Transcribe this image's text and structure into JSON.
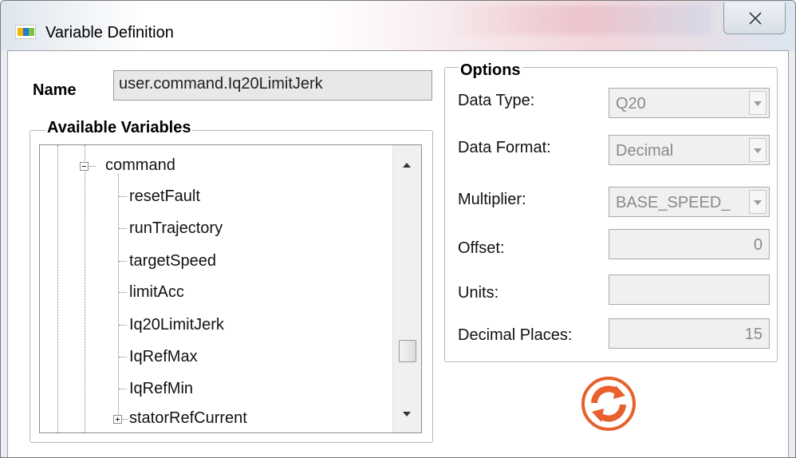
{
  "window": {
    "title": "Variable Definition"
  },
  "name_field": {
    "label": "Name",
    "value": "user.command.Iq20LimitJerk"
  },
  "available_variables": {
    "title": "Available Variables",
    "tree": [
      {
        "label": "command",
        "expander": "minus"
      },
      {
        "label": "resetFault"
      },
      {
        "label": "runTrajectory"
      },
      {
        "label": "targetSpeed"
      },
      {
        "label": "limitAcc"
      },
      {
        "label": "Iq20LimitJerk"
      },
      {
        "label": "IqRefMax"
      },
      {
        "label": "IqRefMin"
      },
      {
        "label": "statorRefCurrent",
        "expander": "plus"
      }
    ]
  },
  "options": {
    "title": "Options",
    "data_type": {
      "label": "Data Type:",
      "value": "Q20"
    },
    "data_format": {
      "label": "Data Format:",
      "value": "Decimal"
    },
    "multiplier": {
      "label": "Multiplier:",
      "value": "BASE_SPEED_"
    },
    "offset": {
      "label": "Offset:",
      "value": "0"
    },
    "units": {
      "label": "Units:",
      "value": ""
    },
    "decimal_places": {
      "label": "Decimal Places:",
      "value": "15"
    }
  },
  "icons": {
    "refresh": "refresh-icon",
    "close": "close-icon",
    "app": "nxp-logo-icon"
  },
  "colors": {
    "accent": "#e8602c"
  }
}
